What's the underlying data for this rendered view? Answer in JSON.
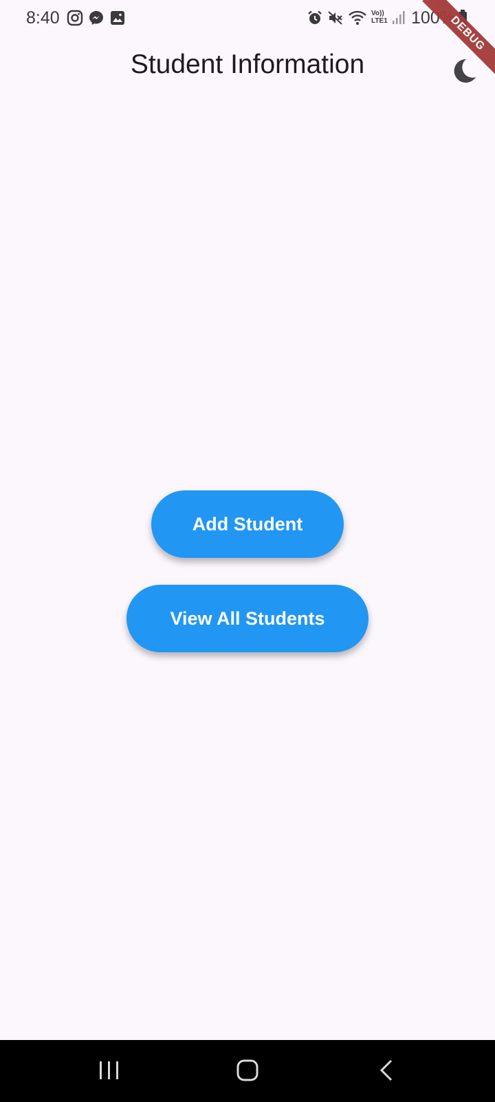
{
  "status_bar": {
    "time": "8:40",
    "battery_percent": "100%",
    "notification_icons": [
      "instagram-icon",
      "messenger-icon",
      "gallery-icon"
    ],
    "system_icons": [
      "alarm-icon",
      "mute-icon",
      "wifi-icon",
      "volte-icon",
      "signal-icon",
      "battery-icon"
    ],
    "volte_label": "Vo)) LTE1"
  },
  "app_bar": {
    "title": "Student Information",
    "theme_toggle_icon": "dark-mode-moon-icon"
  },
  "debug_banner": "DEBUG",
  "actions": {
    "add_student_label": "Add Student",
    "view_all_label": "View All Students"
  },
  "nav_bar": {
    "items": [
      "recent-apps-icon",
      "home-icon",
      "back-icon"
    ]
  },
  "colors": {
    "background": "#fcf6fd",
    "button": "#2196f3",
    "button_text": "#ffffff",
    "title_text": "#1d1b20",
    "debug_ribbon": "#a33a3a",
    "nav_bar": "#000000"
  }
}
